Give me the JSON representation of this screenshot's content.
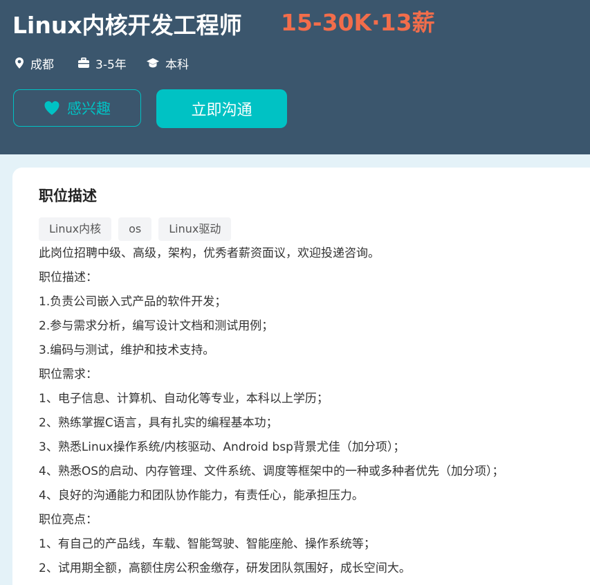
{
  "job": {
    "title": "Linux内核开发工程师",
    "salary": "15-30K·13薪",
    "city": "成都",
    "experience": "3-5年",
    "education": "本科"
  },
  "actions": {
    "interest_label": "感兴趣",
    "chat_label": "立即沟通"
  },
  "description": {
    "heading": "职位描述",
    "tags": [
      "Linux内核",
      "os",
      "Linux驱动"
    ],
    "lines": [
      "此岗位招聘中级、高级，架构，优秀者薪资面议，欢迎投递咨询。",
      "职位描述：",
      "1.负责公司嵌入式产品的软件开发；",
      "2.参与需求分析，编写设计文档和测试用例；",
      "3.编码与测试，维护和技术支持。",
      "职位需求：",
      "1、电子信息、计算机、自动化等专业，本科以上学历；",
      "2、熟练掌握C语言，具有扎实的编程基本功；",
      "3、熟悉Linux操作系统/内核驱动、Android bsp背景尤佳（加分项）；",
      "4、熟悉OS的启动、内存管理、文件系统、调度等框架中的一种或多种者优先（加分项）；",
      "4、良好的沟通能力和团队协作能力，有责任心，能承担压力。",
      "职位亮点：",
      "1、有自己的产品线，车载、智能驾驶、智能座舱、操作系统等；",
      "2、试用期全额，高额住房公积金缴存，研发团队氛围好，成长空间大。"
    ]
  },
  "icons": {
    "city": "location-pin-icon",
    "experience": "briefcase-icon",
    "education": "graduation-cap-icon",
    "interest": "heart-icon"
  },
  "colors": {
    "header_bg": "#3b566d",
    "salary": "#f26d4b",
    "accent": "#00c2c4"
  }
}
